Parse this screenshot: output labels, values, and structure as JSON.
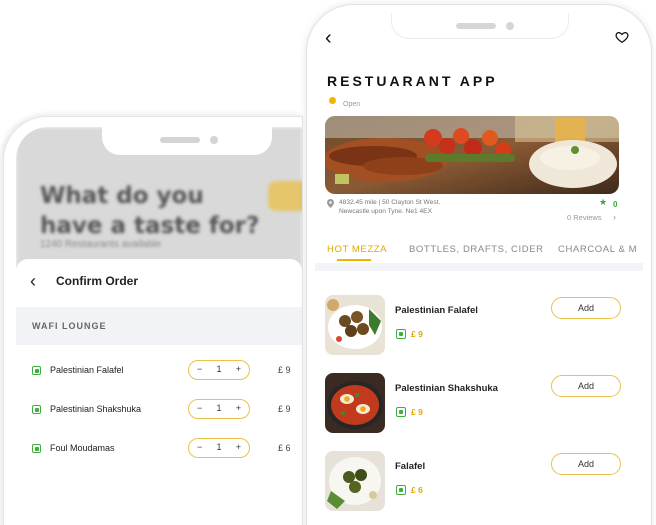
{
  "back_screen": {
    "headline": "What do you have a taste for?",
    "restaurants_count": "1240 Restaurants available",
    "order_sheet": {
      "title": "Confirm Order",
      "section": "WAFI LOUNGE",
      "items": [
        {
          "name": "Palestinian Falafel",
          "qty": "1",
          "price": "£ 9"
        },
        {
          "name": "Palestinian Shakshuka",
          "qty": "1",
          "price": "£ 9"
        },
        {
          "name": "Foul Moudamas",
          "qty": "1",
          "price": "£ 6"
        }
      ],
      "minus_label": "−",
      "plus_label": "+"
    }
  },
  "front_screen": {
    "app_title": "RESTUARANT APP",
    "status": "Open",
    "address_line1": "4832.45 mile | 50 Clayton St West.",
    "address_line2": "Newcastle upon Tyne. Ne1 4EX",
    "rating": "0",
    "reviews": "0 Reviews",
    "tabs": [
      {
        "label": "HOT MEZZA"
      },
      {
        "label": "BOTTLES, DRAFTS, CIDER"
      },
      {
        "label": "CHARCOAL & M"
      }
    ],
    "menu": [
      {
        "name": "Palestinian Falafel",
        "price": "£ 9",
        "add_label": "Add"
      },
      {
        "name": "Palestinian Shakshuka",
        "price": "£ 9",
        "add_label": "Add"
      },
      {
        "name": "Falafel",
        "price": "£ 6",
        "add_label": "Add"
      }
    ]
  },
  "colors": {
    "accent": "#f0b400",
    "veg_green": "#3fae3f",
    "section_bg": "#f2f3f7"
  },
  "icons": [
    "back-arrow-icon",
    "heart-icon",
    "location-pin-icon",
    "star-icon",
    "chevron-right-icon",
    "veg-indicator-icon"
  ]
}
